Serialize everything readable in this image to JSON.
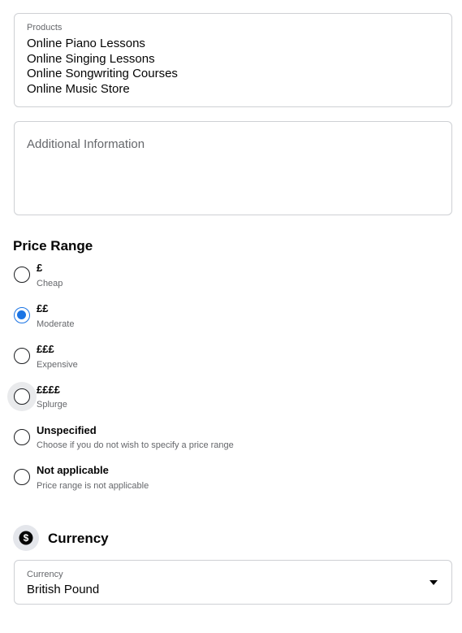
{
  "products": {
    "label": "Products",
    "lines": [
      "Online Piano Lessons",
      "Online Singing Lessons",
      "Online Songwriting Courses",
      "Online Music Store"
    ]
  },
  "additional_info": {
    "placeholder": "Additional Information"
  },
  "price_range": {
    "title": "Price Range",
    "selected_index": 1,
    "hovered_index": 3,
    "options": [
      {
        "label": "£",
        "description": "Cheap"
      },
      {
        "label": "££",
        "description": "Moderate"
      },
      {
        "label": "£££",
        "description": "Expensive"
      },
      {
        "label": "££££",
        "description": "Splurge"
      },
      {
        "label": "Unspecified",
        "description": "Choose if you do not wish to specify a price range"
      },
      {
        "label": "Not applicable",
        "description": "Price range is not applicable"
      }
    ]
  },
  "currency": {
    "title": "Currency",
    "icon": "dollar-circle-icon",
    "select_label": "Currency",
    "select_value": "British Pound"
  },
  "colors": {
    "accent": "#1b74e4",
    "border": "#ced0d4",
    "secondary_text": "#65676b"
  }
}
